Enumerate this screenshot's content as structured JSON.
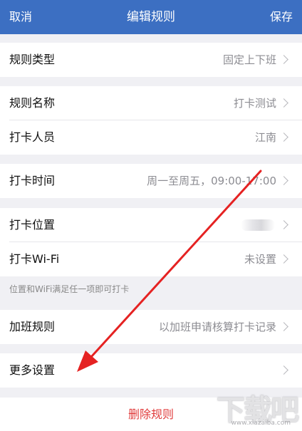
{
  "navbar": {
    "cancel": "取消",
    "title": "编辑规则",
    "save": "保存"
  },
  "rows": {
    "rule_type": {
      "label": "规则类型",
      "value": "固定上下班"
    },
    "rule_name": {
      "label": "规则名称",
      "value": "打卡测试"
    },
    "members": {
      "label": "打卡人员",
      "value": "江南"
    },
    "time": {
      "label": "打卡时间",
      "value": "周一至周五，09:00-17:00"
    },
    "location": {
      "label": "打卡位置"
    },
    "wifi": {
      "label": "打卡Wi-Fi",
      "value": "未设置"
    },
    "overtime": {
      "label": "加班规则",
      "value": "以加班申请核算打卡记录"
    },
    "more": {
      "label": "更多设置"
    }
  },
  "hint": "位置和WiFi满足任一项即可打卡",
  "delete_label": "删除规则",
  "watermark": {
    "logo_text": "下载吧",
    "url": "www.xiazaiba.com"
  },
  "colors": {
    "navbar": "#3c6fc2",
    "delete": "#e03c3c",
    "annotation_arrow": "#e52222"
  }
}
